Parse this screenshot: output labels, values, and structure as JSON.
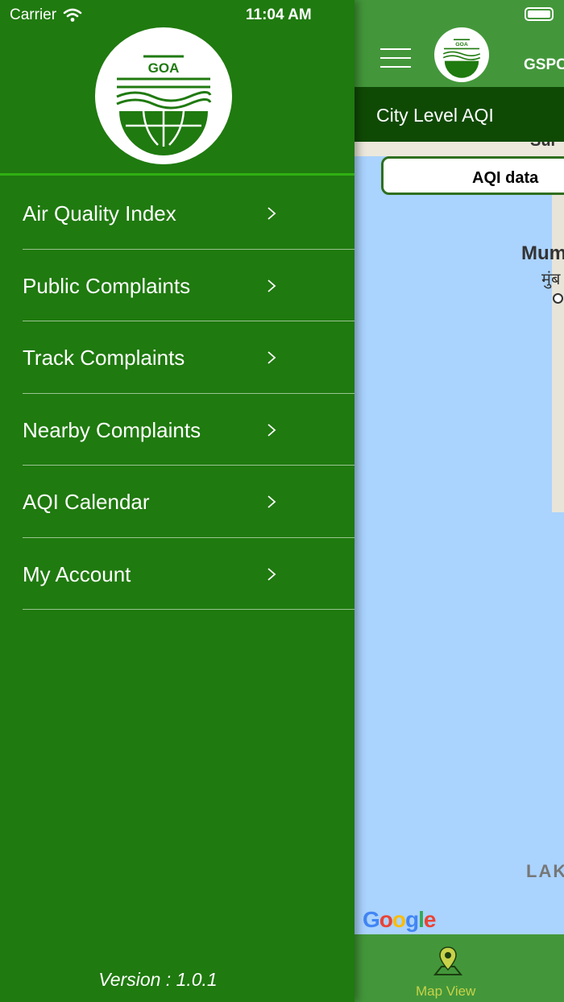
{
  "status": {
    "carrier": "Carrier",
    "time": "11:04 AM"
  },
  "logo": {
    "text": "GOA"
  },
  "menu": [
    {
      "label": "Air Quality Index"
    },
    {
      "label": "Public Complaints"
    },
    {
      "label": "Track Complaints"
    },
    {
      "label": "Nearby Complaints"
    },
    {
      "label": "AQI Calendar"
    },
    {
      "label": "My Account"
    }
  ],
  "version": "Version : 1.0.1",
  "main": {
    "nav_title": "GSPC",
    "sub_header": "City Level AQI",
    "aqi_button": "AQI data",
    "map_labels": {
      "city_en": "Mum",
      "city_hi": "मुंब",
      "top": "Sur",
      "sea": "LAK"
    },
    "google": "Google",
    "tab_label": "Map View"
  },
  "colors": {
    "drawer_bg": "#1f7a0f",
    "nav_bg": "#43973a",
    "sub_header_bg": "#0f4a05",
    "map_water": "#aad3fe",
    "accent_line": "#2fb012"
  }
}
